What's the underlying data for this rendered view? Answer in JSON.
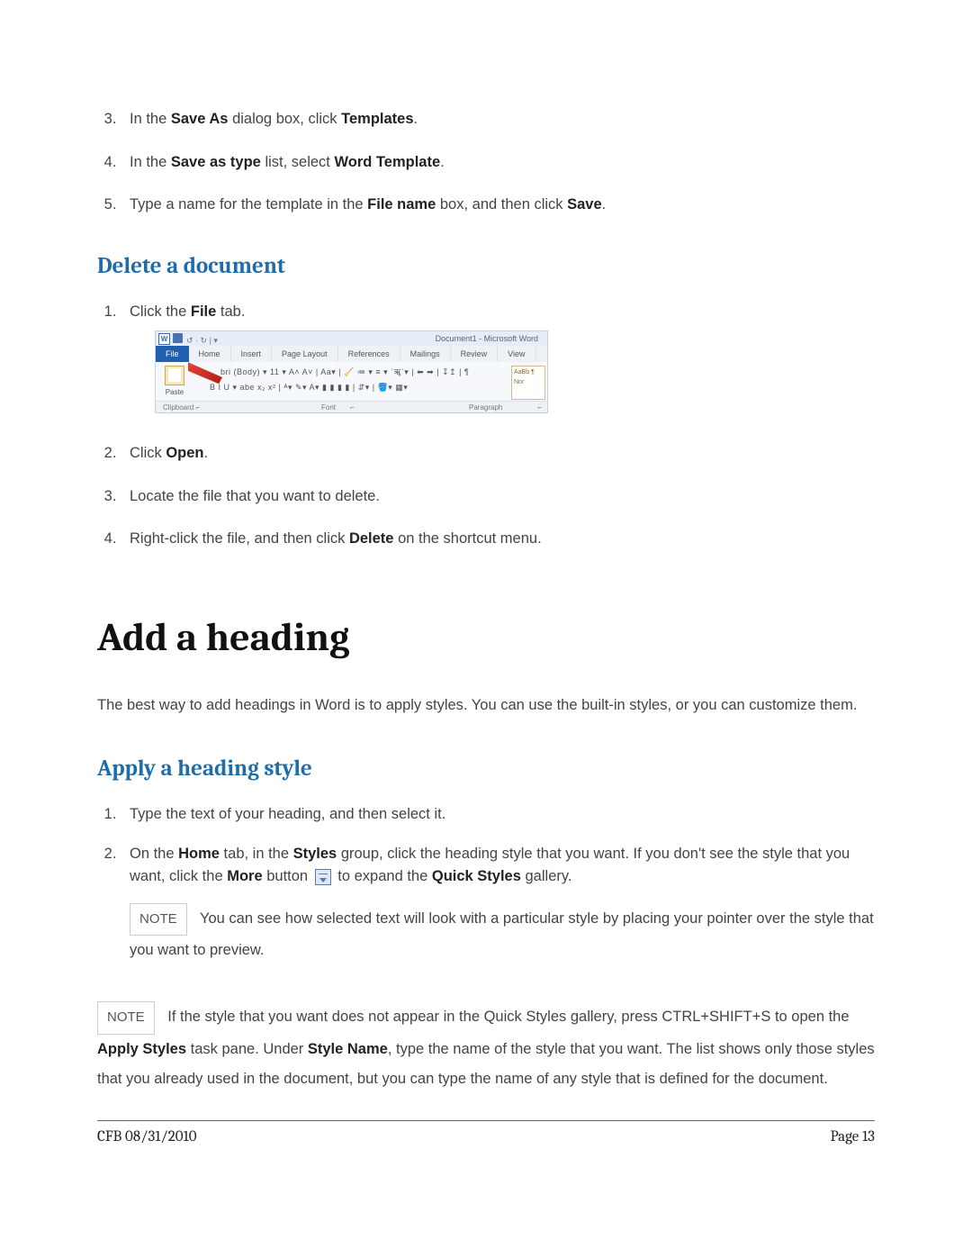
{
  "steps_top": [
    {
      "n": 3,
      "pre": "In the ",
      "b1": "Save As",
      "mid": " dialog box, click ",
      "b2": "Templates",
      "post": "."
    },
    {
      "n": 4,
      "pre": "In the ",
      "b1": "Save as type",
      "mid": " list, select ",
      "b2": "Word Template",
      "post": "."
    },
    {
      "n": 5,
      "pre": "Type a name for the template in the ",
      "b1": "File name",
      "mid": " box, and then click ",
      "b2": "Save",
      "post": "."
    }
  ],
  "section_delete": "Delete a document",
  "delete_steps": {
    "s1_pre": "Click the ",
    "s1_b": "File",
    "s1_post": " tab.",
    "s2_pre": "Click ",
    "s2_b": "Open",
    "s2_post": ".",
    "s3": "Locate the file that you want to delete.",
    "s4_pre": "Right-click the file, and then click ",
    "s4_b": "Delete",
    "s4_post": " on the shortcut menu."
  },
  "ribbon": {
    "w": "W",
    "qat": "↺ · ↻ | ▾",
    "title": "Document1  -  Microsoft Word",
    "tabs": [
      "File",
      "Home",
      "Insert",
      "Page Layout",
      "References",
      "Mailings",
      "Review",
      "View"
    ],
    "paste": "Paste",
    "fontrow": "bri (Body)   ▾  11   ▾   A˄  A˅  | Aa▾ | 🧹    ≔ ▾ ≡ ▾ ˈॠˈ▾ | ⬅ ➡ | ↧↥ | ¶",
    "fontrow2": "B   I   U ▾ abe  x₂  x²  |  ᴬ▾  ✎▾  A▾    ▮ ▮ ▮ ▮  | ⇵▾ | 🪣▾ ▦▾",
    "stylebox": "AaBb\n¶ Nor",
    "labels": [
      "Clipboard  ⌐",
      "",
      "Font",
      "⌐",
      "",
      "Paragraph",
      "⌐"
    ]
  },
  "main_heading": "Add a heading",
  "intro": "The best way to add headings in Word is to apply styles. You can use the built-in styles, or you can customize them.",
  "section_apply": "Apply a heading style",
  "apply": {
    "s1": "Type the text of your heading, and then select it.",
    "s2_p1": "On the ",
    "s2_b1": "Home",
    "s2_p2": " tab, in the ",
    "s2_b2": "Styles",
    "s2_p3": " group, click the heading style that you want. If you don't see the style that you want, click the ",
    "s2_b3": "More",
    "s2_p4": " button ",
    "s2_p5": " to expand the ",
    "s2_b4": "Quick Styles",
    "s2_p6": " gallery.",
    "note_label": "NOTE",
    "note1": "You can see how selected text will look with a particular style by placing your pointer over the style that you want to preview."
  },
  "note2": {
    "label": "NOTE",
    "p1": "If the style that you want does not appear in the Quick Styles gallery, press CTRL+SHIFT+S to open the ",
    "b1": "Apply Styles",
    "p2": " task pane. Under ",
    "b2": "Style Name",
    "p3": ", type the name of the style that you want. The list shows only those styles that you already used in the document, but you can type the name of any style that is defined for the document."
  },
  "footer": {
    "left": "CFB 08/31/2010",
    "right": "Page 13"
  }
}
